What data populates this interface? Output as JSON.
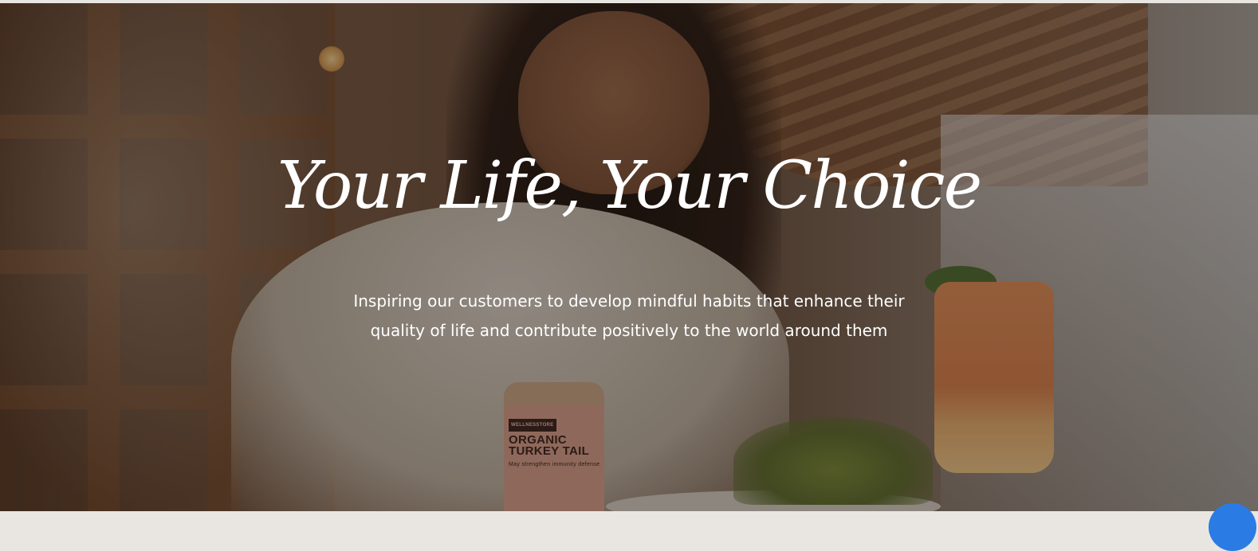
{
  "hero": {
    "headline": "Your Life, Your Choice",
    "subtext_line1": "Inspiring our customers to develop mindful habits that enhance their",
    "subtext_line2": "quality of life and contribute positively to the world around them",
    "product_label": {
      "brand": "WELLNESSTORE",
      "name": "ORGANIC TURKEY TAIL",
      "tagline": "May strengthen immunity defense"
    }
  },
  "colors": {
    "text": "#ffffff",
    "chat_button": "#2a7be4"
  }
}
